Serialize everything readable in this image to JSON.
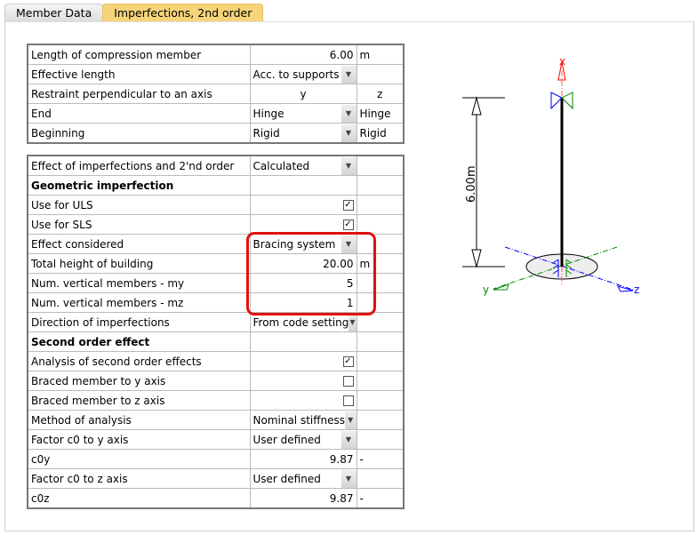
{
  "tabs": [
    "Member Data",
    "Imperfections, 2nd order"
  ],
  "table1": {
    "length_label": "Length of compression member",
    "length_value": "6.00",
    "length_unit": "m",
    "eff_label": "Effective length",
    "eff_value": "Acc. to supports",
    "restraint_label": "Restraint perpendicular to an axis",
    "col_y": "y",
    "col_z": "z",
    "end_label": "End",
    "end_y": "Hinge",
    "end_z": "Hinge",
    "beg_label": "Beginning",
    "beg_y": "Rigid",
    "beg_z": "Rigid"
  },
  "table2": [
    {
      "label": "Effect of imperfections and 2'nd order",
      "type": "select",
      "value": "Calculated"
    },
    {
      "label": "Geometric imperfection",
      "type": "header"
    },
    {
      "label": "Use for ULS",
      "type": "check",
      "checked": true
    },
    {
      "label": "Use for SLS",
      "type": "check",
      "checked": true
    },
    {
      "label": "Effect considered",
      "type": "select",
      "value": "Bracing system"
    },
    {
      "label": "Total height of building",
      "type": "num",
      "value": "20.00",
      "unit": "m"
    },
    {
      "label": "Num. vertical members  - my",
      "type": "num",
      "value": "5",
      "unit": ""
    },
    {
      "label": "Num. vertical members  - mz",
      "type": "num",
      "value": "1",
      "unit": ""
    },
    {
      "label": "Direction of imperfections",
      "type": "select",
      "value": "From code setting"
    },
    {
      "label": "Second order effect",
      "type": "header"
    },
    {
      "label": "Analysis of second order effects",
      "type": "check",
      "checked": true
    },
    {
      "label": "Braced member to y axis",
      "type": "check",
      "checked": false
    },
    {
      "label": "Braced member to z axis",
      "type": "check",
      "checked": false
    },
    {
      "label": "Method of analysis",
      "type": "select",
      "value": "Nominal stiffness"
    },
    {
      "label": "Factor c0 to y axis",
      "type": "select",
      "value": "User defined"
    },
    {
      "label": "c0y",
      "type": "num",
      "value": "9.87",
      "unit": "-"
    },
    {
      "label": "Factor c0 to z axis",
      "type": "select",
      "value": "User defined"
    },
    {
      "label": "c0z",
      "type": "num",
      "value": "9.87",
      "unit": "-"
    }
  ],
  "drawing": {
    "dimension": "6.00m",
    "axis_x": "x",
    "axis_y": "y",
    "axis_z": "z"
  }
}
